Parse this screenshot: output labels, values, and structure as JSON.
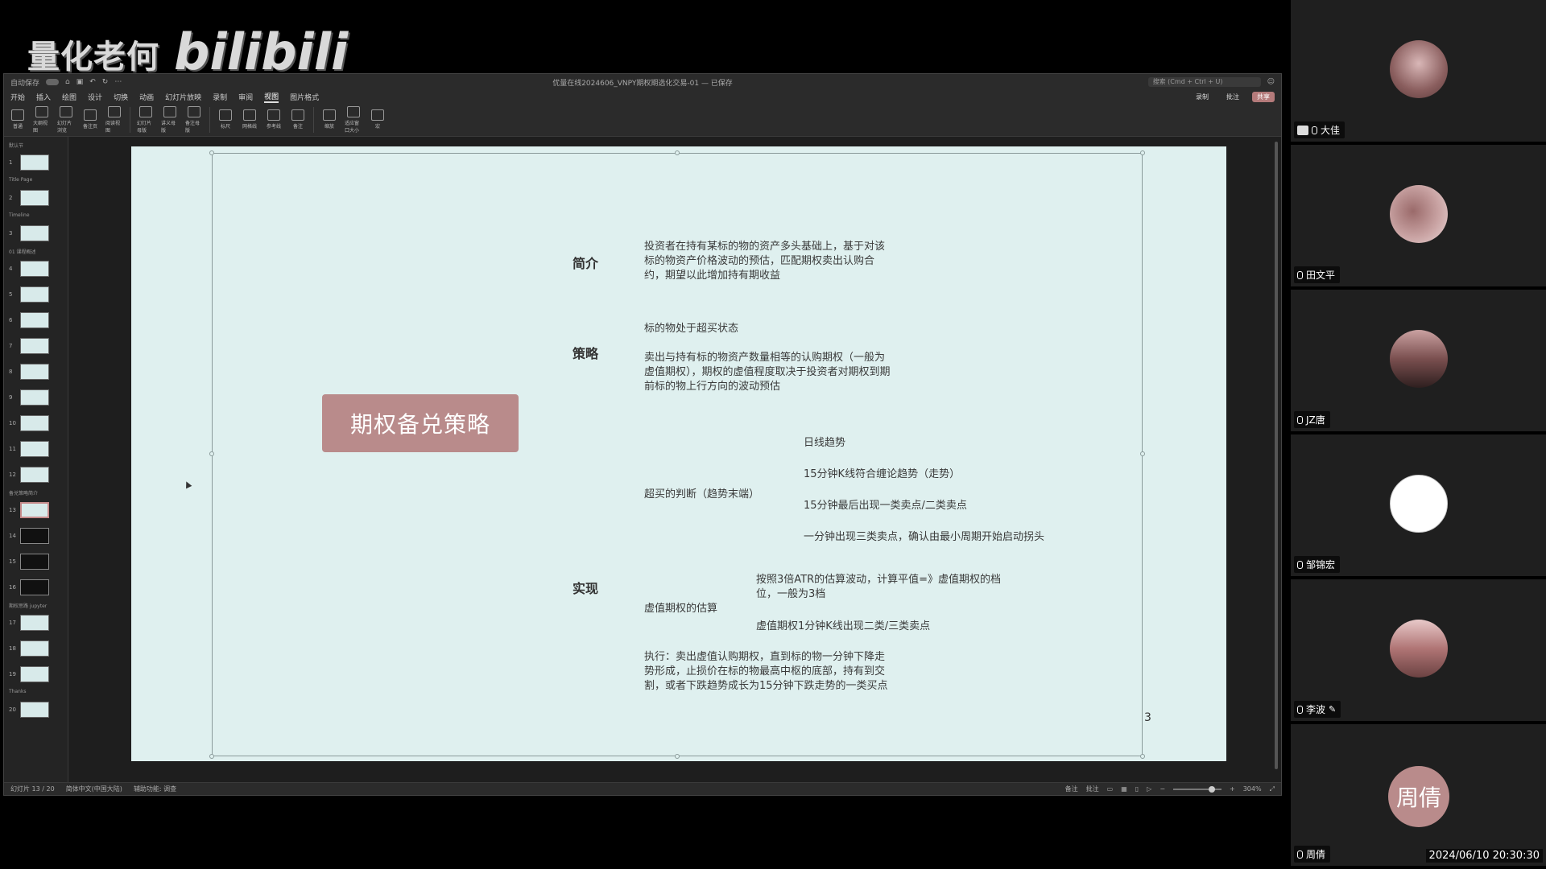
{
  "watermark": {
    "text": "量化老何",
    "logo": "bilibili"
  },
  "window": {
    "title": "优量在线2024606_VNPY期权期选化交易-01 — 已保存",
    "autosave_label": "自动保存",
    "search_placeholder": "搜索 (Cmd + Ctrl + U)",
    "record_label": "录制",
    "comment_label": "批注",
    "share_label": "共享"
  },
  "menu": [
    "开始",
    "插入",
    "绘图",
    "设计",
    "切换",
    "动画",
    "幻灯片放映",
    "录制",
    "审阅",
    "视图",
    "图片格式"
  ],
  "menu_active_index": 9,
  "ribbon": [
    "普通",
    "大纲视图",
    "幻灯片浏览",
    "备注页",
    "阅读视图",
    "幻灯片母版",
    "讲义母版",
    "备注母版",
    "标尺",
    "网格线",
    "参考线",
    "备注",
    "缩放",
    "适应窗口大小",
    "宏"
  ],
  "thumbnails": {
    "sections": [
      "默认节",
      "Title Page",
      "Timeline",
      "01 课程概述",
      "备兑策略简介",
      "期权思路 jupyter",
      "Thanks"
    ],
    "selected": 13,
    "dark": [
      14,
      15,
      16
    ]
  },
  "slide": {
    "title": "期权备兑策略",
    "sections": {
      "intro": "简介",
      "strategy": "策略",
      "impl": "实现"
    },
    "intro_text": "投资者在持有某标的物的资产多头基础上，基于对该标的物资产价格波动的预估，匹配期权卖出认购合约，期望以此增加持有期收益",
    "strategy_line1": "标的物处于超买状态",
    "strategy_line2": "卖出与持有标的物资产数量相等的认购期权（一般为虚值期权），期权的虚值程度取决于投资者对期权到期前标的物上行方向的波动预估",
    "overbought_label": "超买的判断（趋势末端）",
    "overbought_items": [
      "日线趋势",
      "15分钟K线符合缠论趋势（走势）",
      "15分钟最后出现一类卖点/二类卖点",
      "一分钟出现三类卖点，确认由最小周期开始启动拐头"
    ],
    "otm_label": "虚值期权的估算",
    "otm_items": [
      "按照3倍ATR的估算波动，计算平值=》虚值期权的档位，一般为3档",
      "虚值期权1分钟K线出现二类/三类卖点"
    ],
    "execute_text": "执行：卖出虚值认购期权，直到标的物一分钟下降走势形成，止损价在标的物最高中枢的底部，持有到交割，或者下跌趋势成长为15分钟下跌走势的一类买点",
    "page_number": "3"
  },
  "status": {
    "slide_counter": "幻灯片 13 / 20",
    "language": "简体中文(中国大陆)",
    "accessibility": "辅助功能: 调查",
    "notes": "备注",
    "comments": "批注",
    "zoom": "304%"
  },
  "participants": [
    {
      "name": "大佳",
      "avatar": "pic1",
      "muted_icon": "person"
    },
    {
      "name": "田文平",
      "avatar": "pic2"
    },
    {
      "name": "JZ唐",
      "avatar": "pic3"
    },
    {
      "name": "邹锦宏",
      "avatar": "pic4"
    },
    {
      "name": "李波",
      "avatar": "pic5",
      "editing": true
    },
    {
      "name": "周倩",
      "avatar_text": "周倩"
    }
  ],
  "timestamp": "2024/06/10 20:30:30"
}
